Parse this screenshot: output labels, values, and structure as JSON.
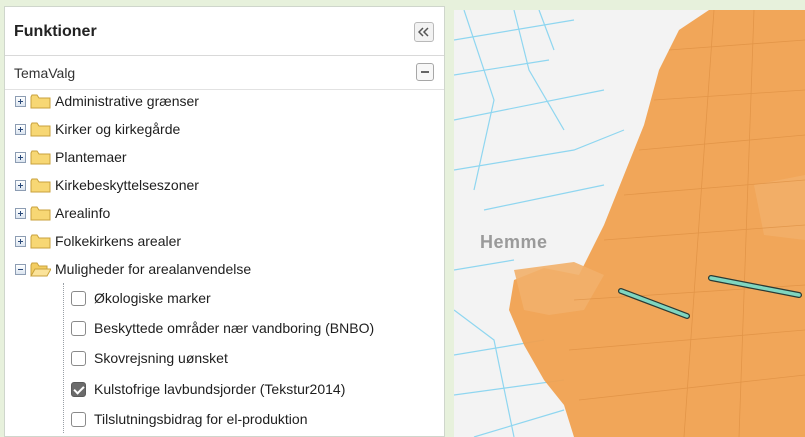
{
  "panel": {
    "title": "Funktioner"
  },
  "tema": {
    "label": "TemaValg"
  },
  "folders": [
    {
      "label": "Administrative grænser",
      "expanded": false
    },
    {
      "label": "Kirker og kirkegårde",
      "expanded": false
    },
    {
      "label": "Plantemaer",
      "expanded": false
    },
    {
      "label": "Kirkebeskyttelseszoner",
      "expanded": false
    },
    {
      "label": "Arealinfo",
      "expanded": false
    },
    {
      "label": "Folkekirkens arealer",
      "expanded": false
    },
    {
      "label": "Muligheder for arealanvendelse",
      "expanded": true
    }
  ],
  "layers": [
    {
      "label": "Økologiske marker",
      "checked": false
    },
    {
      "label": "Beskyttede områder nær vandboring (BNBO)",
      "checked": false
    },
    {
      "label": "Skovrejsning uønsket",
      "checked": false
    },
    {
      "label": "Kulstofrige lavbundsjorder (Tekstur2014)",
      "checked": true
    },
    {
      "label": "Tilslutningsbidrag for el-produktion",
      "checked": false
    }
  ],
  "map": {
    "place": "Hemme"
  },
  "colors": {
    "lowland": "#f0a150",
    "water": "#8fd6f0",
    "marker": "#7fd6c0",
    "background": "#e7f1dc"
  }
}
